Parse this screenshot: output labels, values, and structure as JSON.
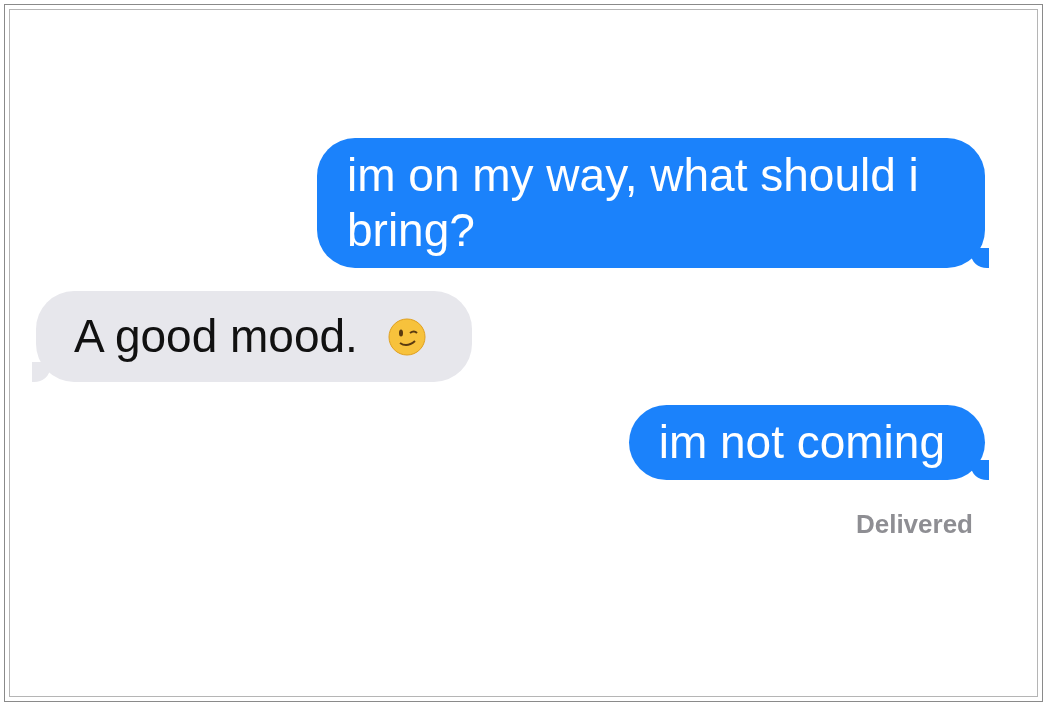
{
  "messages": [
    {
      "kind": "sent",
      "text": "im on my way, what should i bring?",
      "emoji": false
    },
    {
      "kind": "received",
      "text": "A good mood.",
      "emoji": true
    },
    {
      "kind": "sent",
      "text": "im not coming",
      "emoji": false
    }
  ],
  "status": "Delivered"
}
